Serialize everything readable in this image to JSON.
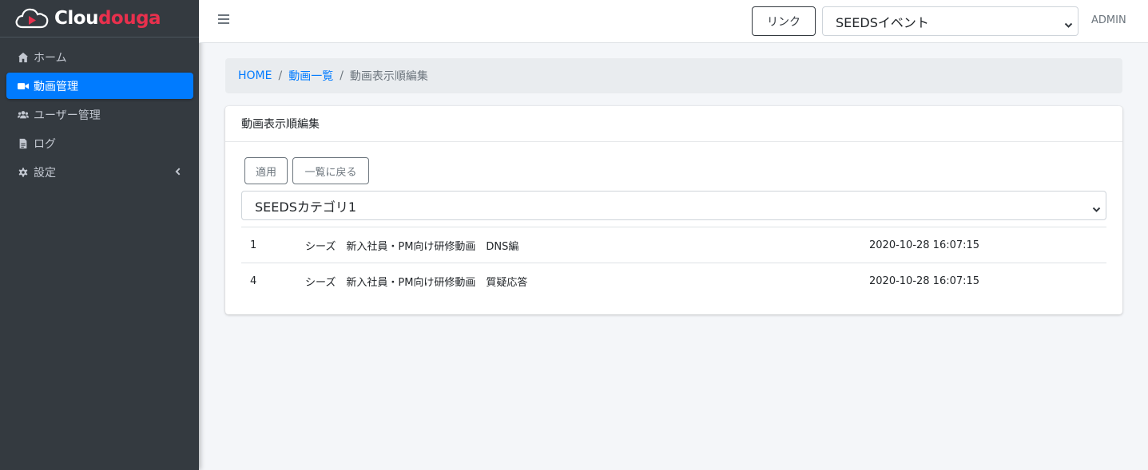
{
  "brand": {
    "name_white_part": "Clou",
    "name_red_part": "douga",
    "colors": {
      "white": "#ffffff",
      "accent": "#e8304d"
    }
  },
  "sidebar": {
    "items": [
      {
        "label": "ホーム",
        "icon": "home-icon",
        "active": false
      },
      {
        "label": "動画管理",
        "icon": "video-camera-icon",
        "active": true
      },
      {
        "label": "ユーザー管理",
        "icon": "users-icon",
        "active": false
      },
      {
        "label": "ログ",
        "icon": "file-icon",
        "active": false
      },
      {
        "label": "設定",
        "icon": "gear-icon",
        "active": false,
        "has_submenu": true
      }
    ]
  },
  "topbar": {
    "link_label": "リンク",
    "event_select_value": "SEEDSイベント",
    "user": "ADMIN"
  },
  "breadcrumb": {
    "home": "HOME",
    "list": "動画一覧",
    "current": "動画表示順編集",
    "separator": "/"
  },
  "card": {
    "title": "動画表示順編集",
    "apply_label": "適用",
    "back_label": "一覧に戻る",
    "category_value": "SEEDSカテゴリ1",
    "rows": [
      {
        "id": "1",
        "title": "シーズ　新入社員・PM向け研修動画　DNS編",
        "date": "2020-10-28 16:07:15"
      },
      {
        "id": "4",
        "title": "シーズ　新入社員・PM向け研修動画　質疑応答",
        "date": "2020-10-28 16:07:15"
      }
    ]
  },
  "colors": {
    "sidebar_bg": "#343a40",
    "active_blue": "#007bff",
    "page_bg": "#f4f6f9"
  }
}
